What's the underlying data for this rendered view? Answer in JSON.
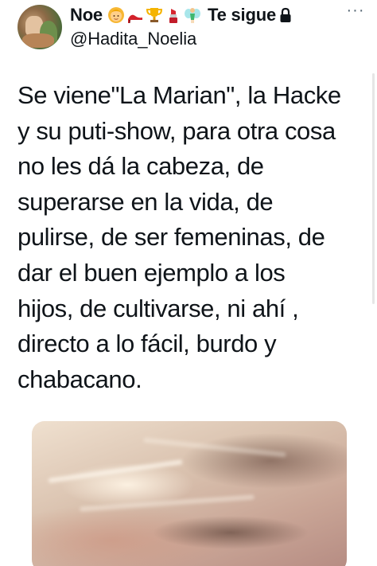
{
  "tweet": {
    "display_name": "Noe",
    "name_emojis": [
      "woman-blond-emoji",
      "high-heel-emoji",
      "trophy-emoji",
      "lipstick-emoji",
      "fairy-emoji"
    ],
    "follows_you": "Te sigue",
    "handle": "@Hadita_Noelia",
    "more_label": "···",
    "text": "Se viene\"La Marian\", la Hacke\ny su puti-show, para otra cosa\nno les dá la cabeza, de\nsuperarse en la vida, de\npulirse, de ser femeninas, de\ndar el buen ejemplo a los\nhijos, de cultivarse, ni ahí ,\ndirecto a lo fácil, burdo y\nchabacano.",
    "media": {
      "icon": "photo-attachment",
      "dominant_colors": [
        "#efe0cf",
        "#c9a596",
        "#5a3c32"
      ]
    }
  },
  "icons": {
    "avatar": "profile-avatar",
    "lock": "lock-icon",
    "more": "more-options-icon"
  }
}
